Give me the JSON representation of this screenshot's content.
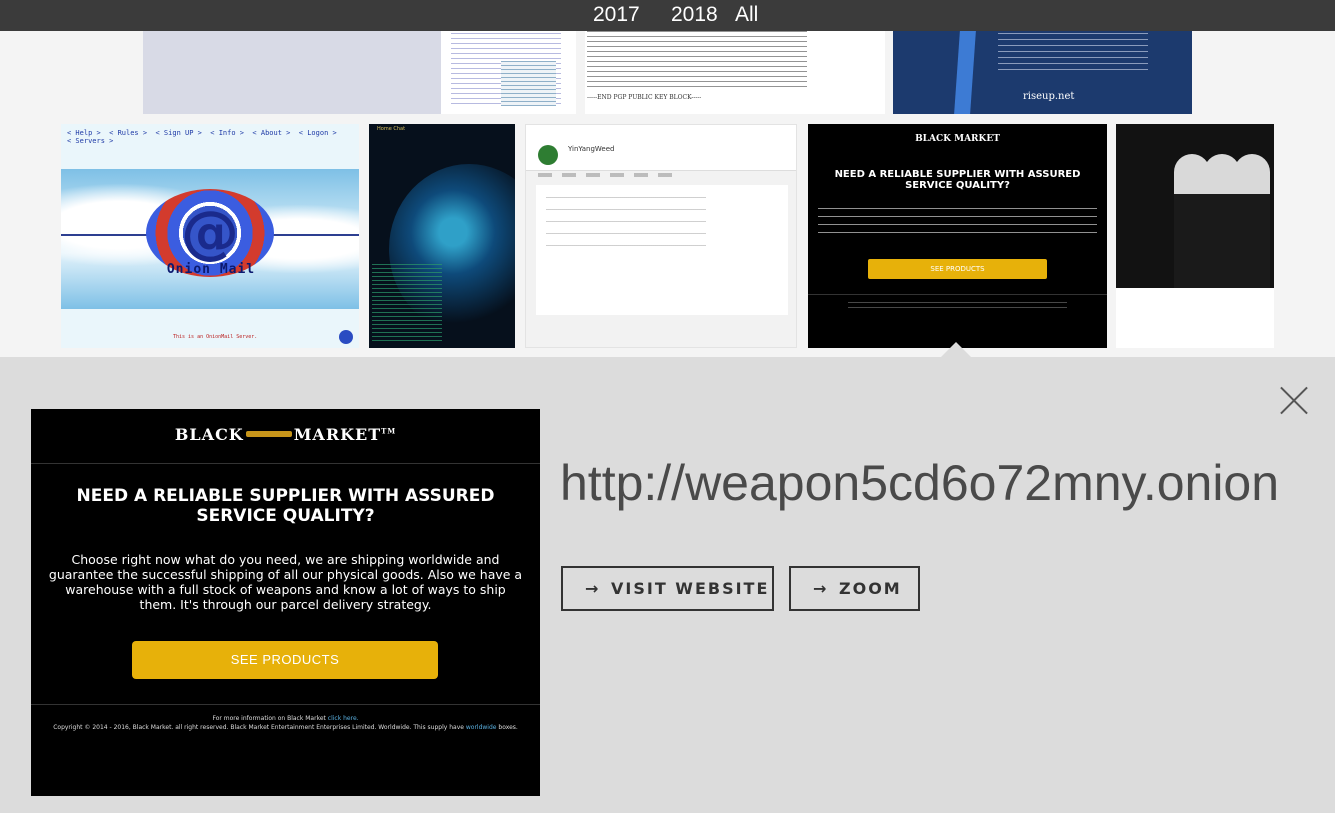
{
  "years": {
    "y2017": "2017",
    "y2018": "2018",
    "all": "All"
  },
  "gallery": {
    "pgp_footer": "-----END PGP PUBLIC KEY BLOCK-----",
    "riseup_logo": "riseup.net",
    "onion": {
      "nav": "< Help >  < Rules >  < Sign UP >  < Info >  < About >  < Logon >\n< Servers >",
      "title": "Onion Mail",
      "footer": "This is an OnionMail Server."
    },
    "hack_tab": "Home    Chat",
    "yin": {
      "title": "YinYangWeed"
    },
    "blackmarket": {
      "logo": "BLACK MARKET",
      "headline": "NEED A RELIABLE SUPPLIER WITH ASSURED SERVICE QUALITY?",
      "button": "SEE PRODUCTS"
    }
  },
  "detail": {
    "url": "http://weapon5cd6o72mny.onion",
    "visit_label": "VISIT WEBSITE",
    "zoom_label": "ZOOM",
    "arrow": "→",
    "close": "close",
    "preview": {
      "logo_left": "BLACK",
      "logo_right": "MARKET",
      "logo_tm": "TM",
      "headline": "NEED A RELIABLE SUPPLIER WITH ASSURED SERVICE QUALITY?",
      "body": "Choose right now what do you need, we are shipping worldwide and guarantee the successful shipping of all our physical goods. Also we have a warehouse with a full stock of weapons and know a lot of ways to ship them. It's through our parcel delivery strategy.",
      "button": "SEE PRODUCTS",
      "footer_info": "For more information on Black Market",
      "footer_info_link": "click here.",
      "footer_copy": "Copyright © 2014 - 2016, Black Market. all right reserved. Black Market Entertainment Enterprises Limited. Worldwide. This supply have",
      "footer_copy_link": "worldwide",
      "footer_copy_end": "boxes."
    }
  }
}
